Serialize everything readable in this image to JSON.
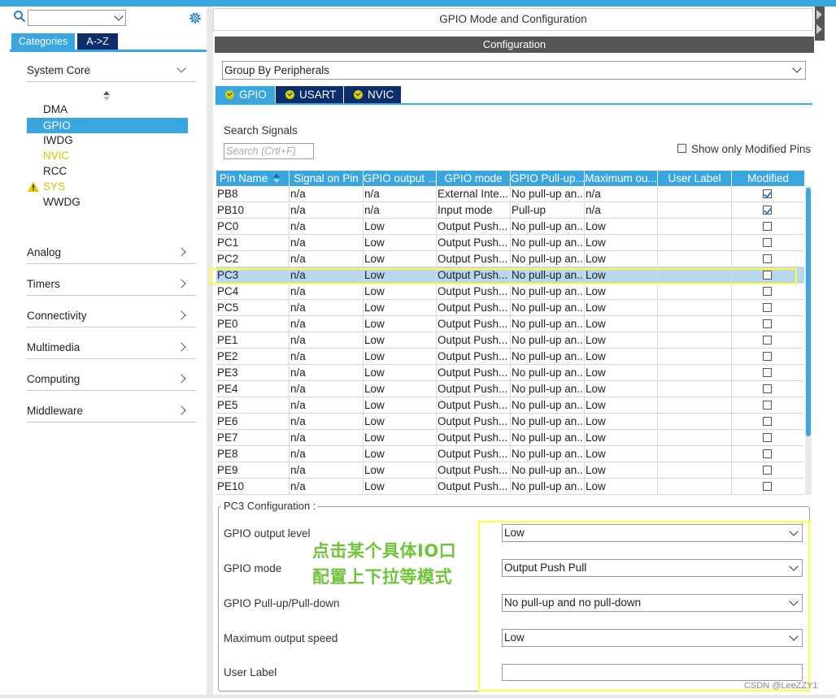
{
  "window": {
    "title": "GPIO Mode and Configuration"
  },
  "left": {
    "search": {
      "value": ""
    },
    "tabs": [
      {
        "label": "Categories"
      },
      {
        "label": "A->Z"
      }
    ],
    "categories": [
      {
        "label": "System Core",
        "expanded": true
      },
      {
        "label": "Analog"
      },
      {
        "label": "Timers"
      },
      {
        "label": "Connectivity"
      },
      {
        "label": "Multimedia"
      },
      {
        "label": "Computing"
      },
      {
        "label": "Middleware"
      }
    ],
    "system_core_items": [
      {
        "label": "DMA"
      },
      {
        "label": "GPIO",
        "selected": true
      },
      {
        "label": "IWDG"
      },
      {
        "label": "NVIC",
        "color": "#c8c800"
      },
      {
        "label": "RCC"
      },
      {
        "label": "SYS",
        "warning": true,
        "color": "#c8c800"
      },
      {
        "label": "WWDG"
      }
    ]
  },
  "main": {
    "config_header": "Configuration",
    "group_by": {
      "value": "Group By Peripherals"
    },
    "peripheral_tabs": [
      {
        "label": "GPIO",
        "active": true
      },
      {
        "label": "USART"
      },
      {
        "label": "NVIC"
      }
    ],
    "search_signals": {
      "label": "Search Signals",
      "placeholder": "Search (Crtl+F)"
    },
    "show_only_modified": {
      "label": "Show only Modified Pins",
      "checked": false
    },
    "table": {
      "columns": [
        "Pin Name",
        "Signal on Pin",
        "GPIO output ...",
        "GPIO mode",
        "GPIO Pull-up...",
        "Maximum ou...",
        "User Label",
        "Modified"
      ],
      "rows": [
        {
          "pin": "PB8",
          "signal": "n/a",
          "output": "n/a",
          "mode": "External Inte...",
          "pull": "No pull-up an...",
          "speed": "n/a",
          "label": "",
          "modified": true
        },
        {
          "pin": "PB10",
          "signal": "n/a",
          "output": "n/a",
          "mode": "Input mode",
          "pull": "Pull-up",
          "speed": "n/a",
          "label": "",
          "modified": true
        },
        {
          "pin": "PC0",
          "signal": "n/a",
          "output": "Low",
          "mode": "Output Push...",
          "pull": "No pull-up an...",
          "speed": "Low",
          "label": "",
          "modified": false
        },
        {
          "pin": "PC1",
          "signal": "n/a",
          "output": "Low",
          "mode": "Output Push...",
          "pull": "No pull-up an...",
          "speed": "Low",
          "label": "",
          "modified": false
        },
        {
          "pin": "PC2",
          "signal": "n/a",
          "output": "Low",
          "mode": "Output Push...",
          "pull": "No pull-up an...",
          "speed": "Low",
          "label": "",
          "modified": false
        },
        {
          "pin": "PC3",
          "signal": "n/a",
          "output": "Low",
          "mode": "Output Push...",
          "pull": "No pull-up an...",
          "speed": "Low",
          "label": "",
          "modified": false,
          "selected": true
        },
        {
          "pin": "PC4",
          "signal": "n/a",
          "output": "Low",
          "mode": "Output Push...",
          "pull": "No pull-up an...",
          "speed": "Low",
          "label": "",
          "modified": false
        },
        {
          "pin": "PC5",
          "signal": "n/a",
          "output": "Low",
          "mode": "Output Push...",
          "pull": "No pull-up an...",
          "speed": "Low",
          "label": "",
          "modified": false
        },
        {
          "pin": "PE0",
          "signal": "n/a",
          "output": "Low",
          "mode": "Output Push...",
          "pull": "No pull-up an...",
          "speed": "Low",
          "label": "",
          "modified": false
        },
        {
          "pin": "PE1",
          "signal": "n/a",
          "output": "Low",
          "mode": "Output Push...",
          "pull": "No pull-up an...",
          "speed": "Low",
          "label": "",
          "modified": false
        },
        {
          "pin": "PE2",
          "signal": "n/a",
          "output": "Low",
          "mode": "Output Push...",
          "pull": "No pull-up an...",
          "speed": "Low",
          "label": "",
          "modified": false
        },
        {
          "pin": "PE3",
          "signal": "n/a",
          "output": "Low",
          "mode": "Output Push...",
          "pull": "No pull-up an...",
          "speed": "Low",
          "label": "",
          "modified": false
        },
        {
          "pin": "PE4",
          "signal": "n/a",
          "output": "Low",
          "mode": "Output Push...",
          "pull": "No pull-up an...",
          "speed": "Low",
          "label": "",
          "modified": false
        },
        {
          "pin": "PE5",
          "signal": "n/a",
          "output": "Low",
          "mode": "Output Push...",
          "pull": "No pull-up an...",
          "speed": "Low",
          "label": "",
          "modified": false
        },
        {
          "pin": "PE6",
          "signal": "n/a",
          "output": "Low",
          "mode": "Output Push...",
          "pull": "No pull-up an...",
          "speed": "Low",
          "label": "",
          "modified": false
        },
        {
          "pin": "PE7",
          "signal": "n/a",
          "output": "Low",
          "mode": "Output Push...",
          "pull": "No pull-up an...",
          "speed": "Low",
          "label": "",
          "modified": false
        },
        {
          "pin": "PE8",
          "signal": "n/a",
          "output": "Low",
          "mode": "Output Push...",
          "pull": "No pull-up an...",
          "speed": "Low",
          "label": "",
          "modified": false
        },
        {
          "pin": "PE9",
          "signal": "n/a",
          "output": "Low",
          "mode": "Output Push...",
          "pull": "No pull-up an...",
          "speed": "Low",
          "label": "",
          "modified": false
        },
        {
          "pin": "PE10",
          "signal": "n/a",
          "output": "Low",
          "mode": "Output Push...",
          "pull": "No pull-up an...",
          "speed": "Low",
          "label": "",
          "modified": false
        }
      ]
    },
    "pin_config": {
      "title": "PC3 Configuration :",
      "fields": [
        {
          "label": "GPIO output level",
          "value": "Low"
        },
        {
          "label": "GPIO mode",
          "value": "Output Push Pull"
        },
        {
          "label": "GPIO Pull-up/Pull-down",
          "value": "No pull-up and no pull-down"
        },
        {
          "label": "Maximum output speed",
          "value": "Low"
        },
        {
          "label": "User Label",
          "value": ""
        }
      ]
    },
    "annotation": {
      "line1": "点击某个具体IO口",
      "line2": "配置上下拉等模式"
    },
    "watermark": "CSDN @LeeZZY1"
  },
  "colors": {
    "accent": "#39a6df",
    "dark_tab": "#0b2d6b",
    "warning": "#c8c800",
    "highlight": "#ffff3b",
    "note": "#6fc43a"
  }
}
